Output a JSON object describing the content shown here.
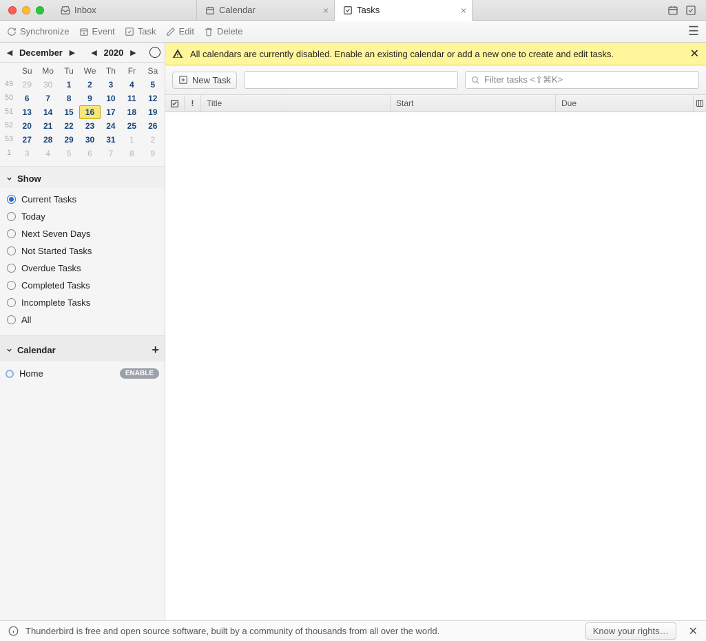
{
  "tabs": {
    "inbox": "Inbox",
    "calendar": "Calendar",
    "tasks": "Tasks"
  },
  "toolbar": {
    "sync": "Synchronize",
    "event": "Event",
    "task": "Task",
    "edit": "Edit",
    "delete": "Delete"
  },
  "mini_cal": {
    "month": "December",
    "year": "2020",
    "dow": [
      "Su",
      "Mo",
      "Tu",
      "We",
      "Th",
      "Fr",
      "Sa"
    ],
    "weeks": [
      {
        "wk": "49",
        "days": [
          {
            "n": "29",
            "o": true
          },
          {
            "n": "30",
            "o": true
          },
          {
            "n": "1"
          },
          {
            "n": "2"
          },
          {
            "n": "3"
          },
          {
            "n": "4"
          },
          {
            "n": "5"
          }
        ]
      },
      {
        "wk": "50",
        "days": [
          {
            "n": "6"
          },
          {
            "n": "7"
          },
          {
            "n": "8"
          },
          {
            "n": "9"
          },
          {
            "n": "10"
          },
          {
            "n": "11"
          },
          {
            "n": "12"
          }
        ]
      },
      {
        "wk": "51",
        "days": [
          {
            "n": "13"
          },
          {
            "n": "14"
          },
          {
            "n": "15"
          },
          {
            "n": "16",
            "sel": true
          },
          {
            "n": "17"
          },
          {
            "n": "18"
          },
          {
            "n": "19"
          }
        ]
      },
      {
        "wk": "52",
        "days": [
          {
            "n": "20"
          },
          {
            "n": "21"
          },
          {
            "n": "22"
          },
          {
            "n": "23"
          },
          {
            "n": "24"
          },
          {
            "n": "25"
          },
          {
            "n": "26"
          }
        ]
      },
      {
        "wk": "53",
        "days": [
          {
            "n": "27"
          },
          {
            "n": "28"
          },
          {
            "n": "29"
          },
          {
            "n": "30"
          },
          {
            "n": "31"
          },
          {
            "n": "1",
            "o": true
          },
          {
            "n": "2",
            "o": true
          }
        ]
      },
      {
        "wk": "1",
        "days": [
          {
            "n": "3",
            "o": true
          },
          {
            "n": "4",
            "o": true
          },
          {
            "n": "5",
            "o": true
          },
          {
            "n": "6",
            "o": true
          },
          {
            "n": "7",
            "o": true
          },
          {
            "n": "8",
            "o": true
          },
          {
            "n": "9",
            "o": true
          }
        ]
      }
    ]
  },
  "show": {
    "heading": "Show",
    "options": [
      "Current Tasks",
      "Today",
      "Next Seven Days",
      "Not Started Tasks",
      "Overdue Tasks",
      "Completed Tasks",
      "Incomplete Tasks",
      "All"
    ],
    "selected": 0
  },
  "calendars": {
    "heading": "Calendar",
    "items": [
      {
        "name": "Home",
        "enable": "ENABLE"
      }
    ]
  },
  "alert": "All calendars are currently disabled. Enable an existing calendar or add a new one to create and edit tasks.",
  "taskbar": {
    "newtask": "New Task",
    "filter": "Filter tasks <⇧⌘K>"
  },
  "columns": {
    "title": "Title",
    "start": "Start",
    "due": "Due"
  },
  "footer": {
    "msg": "Thunderbird is free and open source software, built by a community of thousands from all over the world.",
    "btn": "Know your rights…"
  }
}
